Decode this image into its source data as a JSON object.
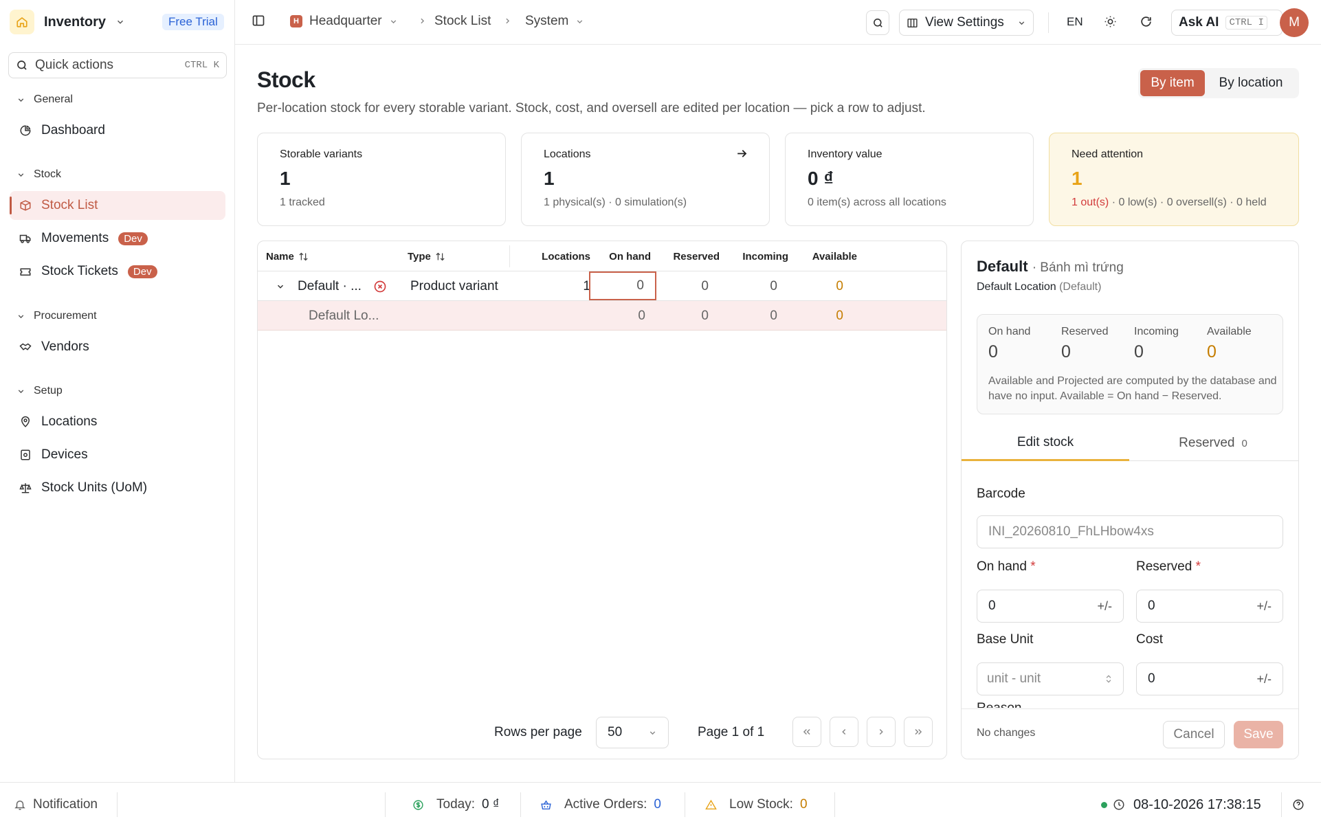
{
  "app": {
    "name": "Inventory",
    "trial_badge": "Free Trial"
  },
  "search": {
    "label": "Quick actions",
    "shortcut": "CTRL K"
  },
  "sidebar": {
    "groups": [
      {
        "label": "General",
        "items": [
          {
            "label": "Dashboard"
          }
        ]
      },
      {
        "label": "Stock",
        "items": [
          {
            "label": "Stock List"
          },
          {
            "label": "Movements",
            "badge": "Dev"
          },
          {
            "label": "Stock Tickets",
            "badge": "Dev"
          }
        ]
      },
      {
        "label": "Procurement",
        "items": [
          {
            "label": "Vendors"
          }
        ]
      },
      {
        "label": "Setup",
        "items": [
          {
            "label": "Locations"
          },
          {
            "label": "Devices"
          },
          {
            "label": "Stock Units (UoM)"
          }
        ]
      }
    ]
  },
  "topbar": {
    "breadcrumb": [
      {
        "badge": "H",
        "label": "Headquarter"
      },
      {
        "label": "Stock List"
      },
      {
        "label": "System"
      }
    ],
    "view_settings": "View Settings",
    "language": "EN",
    "ask_ai": "Ask AI",
    "ask_ai_shortcut": "CTRL I",
    "avatar_initial": "M"
  },
  "page": {
    "title": "Stock",
    "subtitle": "Per-location stock for every storable variant. Stock, cost, and oversell are edited per location — pick a row to adjust.",
    "view_toggle": {
      "by_item": "By item",
      "by_location": "By location"
    }
  },
  "stats": [
    {
      "label": "Storable variants",
      "value": "1",
      "sub": "1 tracked"
    },
    {
      "label": "Locations",
      "value": "1",
      "sub": "1 physical(s) · 0 simulation(s)"
    },
    {
      "label": "Inventory value",
      "value": "0 ₫",
      "sub": "0 item(s) across all locations"
    },
    {
      "label": "Need attention",
      "value": "1",
      "sub_highlight": "1 out(s)",
      "sub": " · 0 low(s) · 0 oversell(s) · 0 held"
    }
  ],
  "table": {
    "columns": {
      "name": "Name",
      "type": "Type",
      "locations": "Locations",
      "on_hand": "On hand",
      "reserved": "Reserved",
      "incoming": "Incoming",
      "available": "Available"
    },
    "rows": [
      {
        "name": "Default · ...",
        "type": "Product variant",
        "locations": "1",
        "on_hand": "0",
        "reserved": "0",
        "incoming": "0",
        "available": "0"
      },
      {
        "name": "Default Lo...",
        "on_hand": "0",
        "reserved": "0",
        "incoming": "0",
        "available": "0"
      }
    ],
    "pagination": {
      "rows_per_page_label": "Rows per page",
      "rows_per_page": "50",
      "page_info": "Page 1 of 1"
    }
  },
  "detail": {
    "title": "Default",
    "title_suffix": "· Bánh mì trứng",
    "location": "Default Location",
    "location_note": "(Default)",
    "summary": {
      "on_hand_label": "On hand",
      "on_hand": "0",
      "reserved_label": "Reserved",
      "reserved": "0",
      "incoming_label": "Incoming",
      "incoming": "0",
      "available_label": "Available",
      "available": "0",
      "note": "Available and Projected are computed by the database and have no input. Available = On hand − Reserved."
    },
    "tabs": {
      "edit": "Edit stock",
      "reserved": "Reserved",
      "reserved_count": "0"
    },
    "form": {
      "barcode_label": "Barcode",
      "barcode_value": "INI_20260810_FhLHbow4xs",
      "on_hand_label": "On hand",
      "on_hand_value": "0",
      "reserved_label": "Reserved",
      "reserved_value": "0",
      "required_mark": "*",
      "adjust": "+/-",
      "base_unit_label": "Base Unit",
      "base_unit_value": "unit - unit",
      "cost_label": "Cost",
      "cost_value": "0",
      "reason_label": "Reason"
    },
    "footer": {
      "status": "No changes",
      "cancel": "Cancel",
      "save": "Save"
    }
  },
  "statusbar": {
    "notification": "Notification",
    "today_label": "Today:",
    "today_value": "0 ₫",
    "orders_label": "Active Orders:",
    "orders_value": "0",
    "low_label": "Low Stock:",
    "low_value": "0",
    "datetime": "08-10-2026 17:38:15"
  },
  "colors": {
    "accent": "#c9614a",
    "available": "#c57d00",
    "attention_bg": "#fdf7e6",
    "tab_underline": "#e9b23c"
  }
}
